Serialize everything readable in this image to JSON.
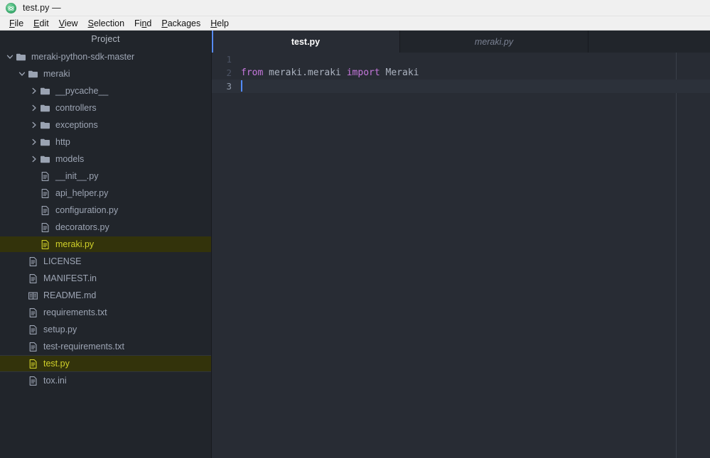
{
  "window": {
    "title": "test.py —",
    "icon": "atom-logo-icon"
  },
  "menubar": {
    "items": [
      {
        "label": "File",
        "accesskey": "F"
      },
      {
        "label": "Edit",
        "accesskey": "E"
      },
      {
        "label": "View",
        "accesskey": "V"
      },
      {
        "label": "Selection",
        "accesskey": "S"
      },
      {
        "label": "Find",
        "accesskey": "n"
      },
      {
        "label": "Packages",
        "accesskey": "P"
      },
      {
        "label": "Help",
        "accesskey": "H"
      }
    ]
  },
  "tree": {
    "header": "Project",
    "items": [
      {
        "label": "meraki-python-sdk-master",
        "type": "folder",
        "depth": 0,
        "expanded": true,
        "modified": false,
        "selected": false
      },
      {
        "label": "meraki",
        "type": "folder",
        "depth": 1,
        "expanded": true,
        "modified": false,
        "selected": false
      },
      {
        "label": "__pycache__",
        "type": "folder",
        "depth": 2,
        "expanded": false,
        "modified": false,
        "selected": false
      },
      {
        "label": "controllers",
        "type": "folder",
        "depth": 2,
        "expanded": false,
        "modified": false,
        "selected": false
      },
      {
        "label": "exceptions",
        "type": "folder",
        "depth": 2,
        "expanded": false,
        "modified": false,
        "selected": false
      },
      {
        "label": "http",
        "type": "folder",
        "depth": 2,
        "expanded": false,
        "modified": false,
        "selected": false
      },
      {
        "label": "models",
        "type": "folder",
        "depth": 2,
        "expanded": false,
        "modified": false,
        "selected": false
      },
      {
        "label": "__init__.py",
        "type": "file",
        "depth": 2,
        "expanded": false,
        "modified": false,
        "selected": false
      },
      {
        "label": "api_helper.py",
        "type": "file",
        "depth": 2,
        "expanded": false,
        "modified": false,
        "selected": false
      },
      {
        "label": "configuration.py",
        "type": "file",
        "depth": 2,
        "expanded": false,
        "modified": false,
        "selected": false
      },
      {
        "label": "decorators.py",
        "type": "file",
        "depth": 2,
        "expanded": false,
        "modified": false,
        "selected": false
      },
      {
        "label": "meraki.py",
        "type": "file",
        "depth": 2,
        "expanded": false,
        "modified": true,
        "selected": false
      },
      {
        "label": "LICENSE",
        "type": "file",
        "depth": 1,
        "expanded": false,
        "modified": false,
        "selected": false
      },
      {
        "label": "MANIFEST.in",
        "type": "file",
        "depth": 1,
        "expanded": false,
        "modified": false,
        "selected": false
      },
      {
        "label": "README.md",
        "type": "book",
        "depth": 1,
        "expanded": false,
        "modified": false,
        "selected": false
      },
      {
        "label": "requirements.txt",
        "type": "file",
        "depth": 1,
        "expanded": false,
        "modified": false,
        "selected": false
      },
      {
        "label": "setup.py",
        "type": "file",
        "depth": 1,
        "expanded": false,
        "modified": false,
        "selected": false
      },
      {
        "label": "test-requirements.txt",
        "type": "file",
        "depth": 1,
        "expanded": false,
        "modified": false,
        "selected": false
      },
      {
        "label": "test.py",
        "type": "file",
        "depth": 1,
        "expanded": false,
        "modified": true,
        "selected": true
      },
      {
        "label": "tox.ini",
        "type": "file",
        "depth": 1,
        "expanded": false,
        "modified": false,
        "selected": false
      }
    ]
  },
  "editor": {
    "tabs": [
      {
        "label": "test.py",
        "active": true
      },
      {
        "label": "meraki.py",
        "active": false
      }
    ],
    "lines": [
      {
        "number": "1",
        "tokens": [],
        "active": false,
        "cursor": false
      },
      {
        "number": "2",
        "tokens": [
          {
            "text": "from ",
            "kind": "keyword"
          },
          {
            "text": "meraki.meraki ",
            "kind": "plain"
          },
          {
            "text": "import ",
            "kind": "keyword"
          },
          {
            "text": "Meraki",
            "kind": "plain"
          }
        ],
        "active": false,
        "cursor": false
      },
      {
        "number": "3",
        "tokens": [],
        "active": true,
        "cursor": true
      }
    ]
  },
  "colors": {
    "editor_bg": "#282c34",
    "panel_bg": "#21252b",
    "accent_blue": "#568af2",
    "cursor_blue": "#528bff",
    "keyword": "#c678dd",
    "text": "#abb2bf",
    "modified": "#d0d02a",
    "modified_bg": "#33330b"
  }
}
